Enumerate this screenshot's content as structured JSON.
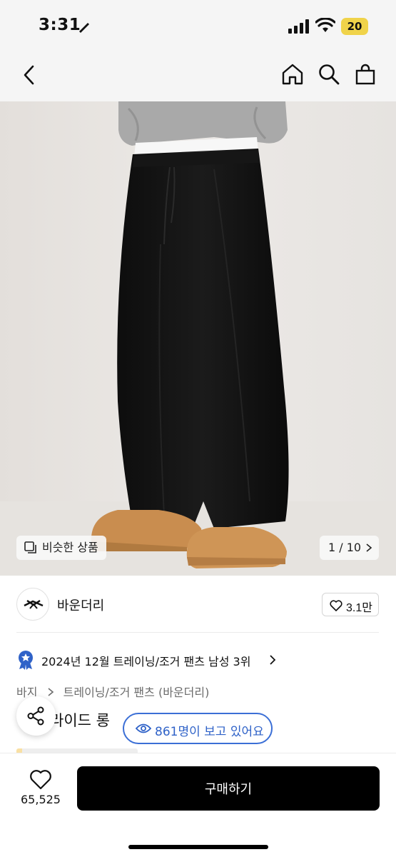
{
  "status_bar": {
    "time": "3:31",
    "battery": "20"
  },
  "nav": {
    "icons": [
      "back-icon",
      "home-icon",
      "search-icon",
      "cart-icon"
    ]
  },
  "image": {
    "similar_label": "비슷한 상품",
    "counter": "1 / 10"
  },
  "brand": {
    "name": "바운더리",
    "likes": "3.1만"
  },
  "ranking": {
    "text": "2024년 12월 트레이닝/조거 팬츠 남성 3위"
  },
  "breadcrumb": {
    "items": [
      "바지",
      "트레이닝/조거 팬츠 (바운더리)"
    ]
  },
  "product": {
    "title_partial": "라이드 롱"
  },
  "viewers": {
    "text": "861명이 보고 있어요"
  },
  "bottom": {
    "wish_count": "65,525",
    "buy_label": "구매하기"
  },
  "colors": {
    "accent_blue": "#2f62c8",
    "buy_bg": "#000000",
    "battery": "#f0d34a"
  }
}
